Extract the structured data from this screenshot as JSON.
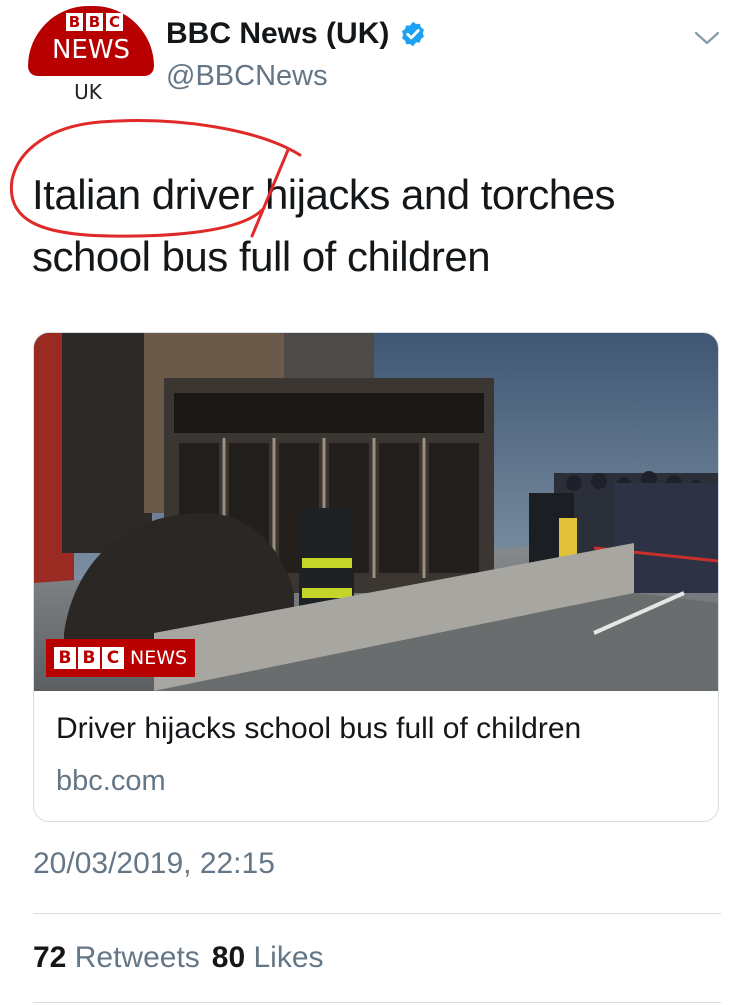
{
  "tweet": {
    "author": {
      "display_name": "BBC News (UK)",
      "handle": "@BBCNews",
      "verified": true,
      "avatar": {
        "letters": [
          "B",
          "B",
          "C"
        ],
        "news_word": "NEWS",
        "region": "UK"
      }
    },
    "text_line1_before": "Italian driver",
    "text_line1_after": "hijacks and torches",
    "text_line2": "school bus full of children",
    "card": {
      "badge_letters": [
        "B",
        "B",
        "C"
      ],
      "badge_news": "NEWS",
      "title": "Driver hijacks school bus full of children",
      "domain": "bbc.com"
    },
    "timestamp": "20/03/2019, 22:15",
    "stats": {
      "retweets_count": "72",
      "retweets_label": "Retweets",
      "likes_count": "80",
      "likes_label": "Likes"
    }
  },
  "colors": {
    "bbc_red": "#b80000",
    "verified_blue": "#1da1f2",
    "secondary_text": "#657786",
    "annotation_red": "#e02a2a"
  },
  "icons": {
    "verified": "verified-badge-icon",
    "caret": "chevron-down-icon"
  }
}
